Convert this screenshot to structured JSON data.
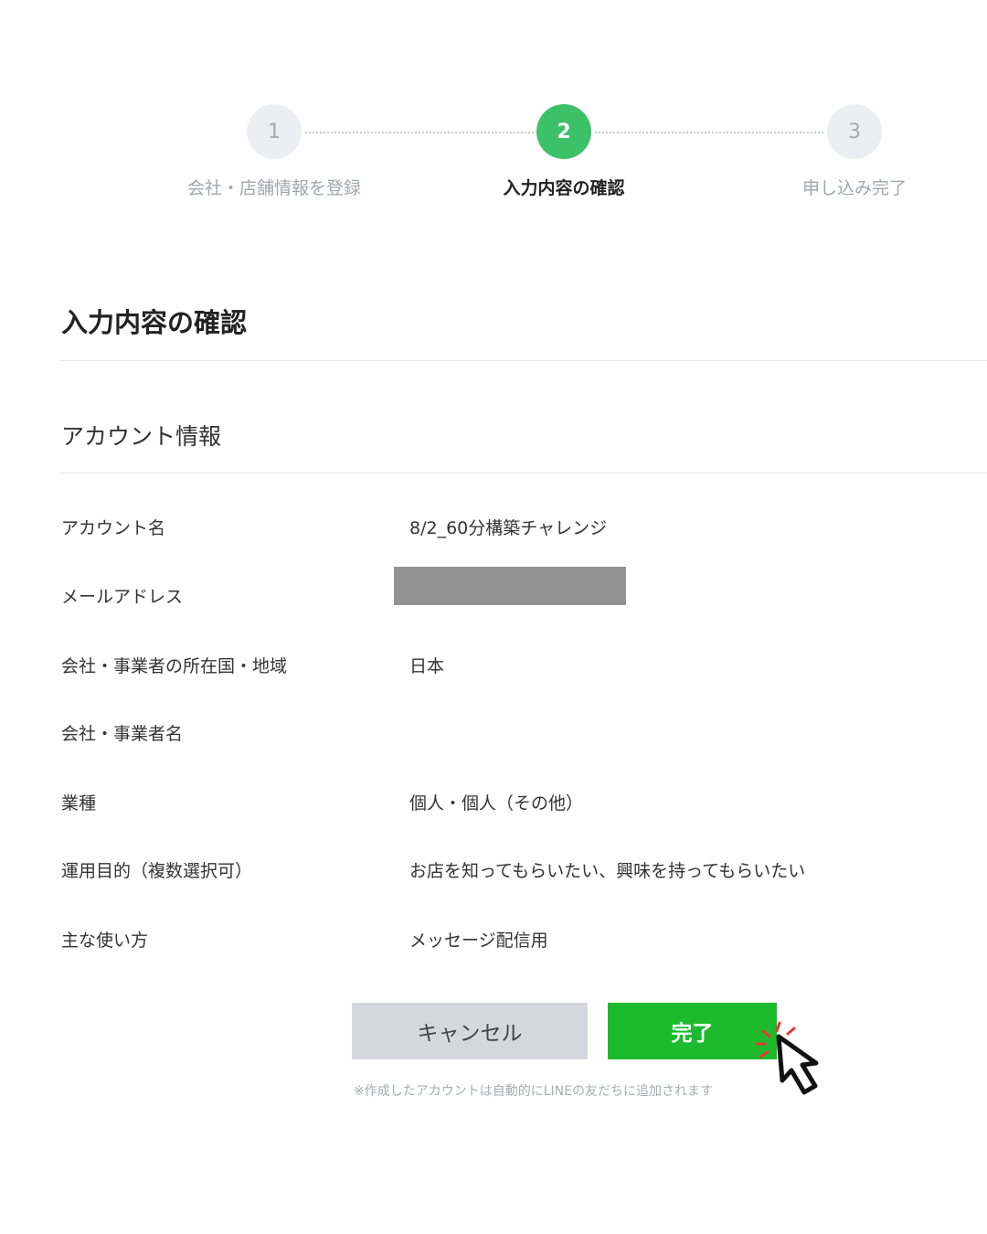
{
  "stepper": {
    "steps": [
      {
        "number": "1",
        "label": "会社・店舗情報を登録",
        "state": "done"
      },
      {
        "number": "2",
        "label": "入力内容の確認",
        "state": "active"
      },
      {
        "number": "3",
        "label": "申し込み完了",
        "state": "pending"
      }
    ],
    "active_color": "#3cc169",
    "inactive_color": "#eceef1"
  },
  "page_title": "入力内容の確認",
  "section_title": "アカウント情報",
  "fields": [
    {
      "label": "アカウント名",
      "value": "8/2_60分構築チャレンジ"
    },
    {
      "label": "メールアドレス",
      "value": ""
    },
    {
      "label": "会社・事業者の所在国・地域",
      "value": "日本"
    },
    {
      "label": "会社・事業者名",
      "value": ""
    },
    {
      "label": "業種",
      "value": "個人・個人（その他）"
    },
    {
      "label": "運用目的（複数選択可）",
      "value": "お店を知ってもらいたい、興味を持ってもらいたい"
    },
    {
      "label": "主な使い方",
      "value": "メッセージ配信用"
    }
  ],
  "buttons": {
    "cancel": "キャンセル",
    "done": "完了",
    "done_color": "#1cbb2e"
  },
  "note": "※作成したアカウントは自動的にLINEの友だちに追加されます",
  "icons": {
    "pointer": "hand-pointer-click-icon"
  }
}
